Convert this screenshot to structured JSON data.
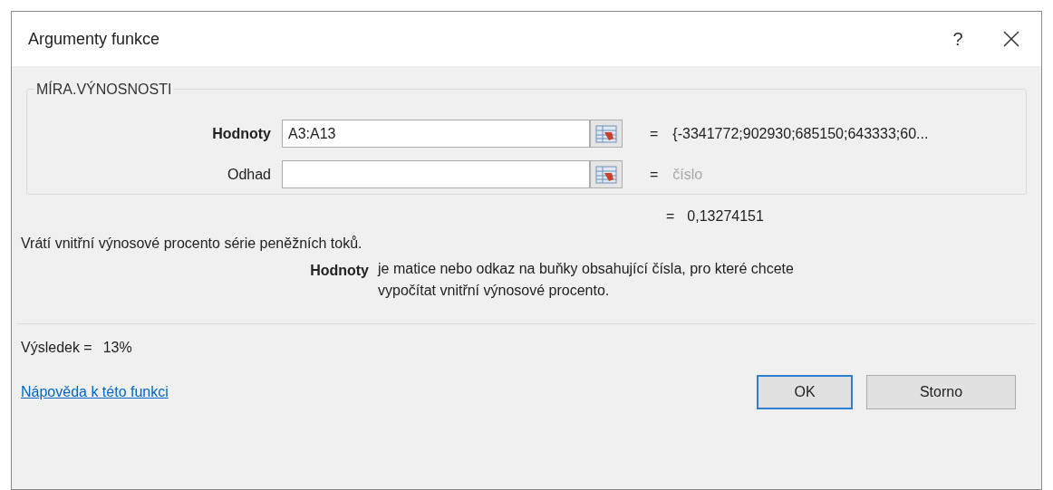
{
  "window": {
    "title": "Argumenty funkce",
    "help": "?"
  },
  "function_name": "MÍRA.VÝNOSNOSTI",
  "arguments": [
    {
      "label": "Hodnoty",
      "value": "A3:A13",
      "selected": true,
      "equals": "=",
      "result": "{-3341772;902930;685150;643333;60...",
      "result_muted": false
    },
    {
      "label": "Odhad",
      "selected": false,
      "equals": "=",
      "result": "číslo",
      "result_muted": true
    }
  ],
  "formula_result": {
    "equals": "=",
    "value": "0,13274151"
  },
  "description": "Vrátí vnitřní výnosové procento série peněžních toků.",
  "argument_help": {
    "label": "Hodnoty",
    "text": "je matice nebo odkaz na buňky obsahující čísla, pro které chcete vypočítat vnitřní výnosové procento."
  },
  "result_line": {
    "label": "Výsledek =",
    "value": "13%"
  },
  "help_link": "Nápověda k této funkci",
  "buttons": [
    {
      "label": "OK",
      "selected": true
    },
    {
      "label": "Storno",
      "selected": false
    }
  ]
}
